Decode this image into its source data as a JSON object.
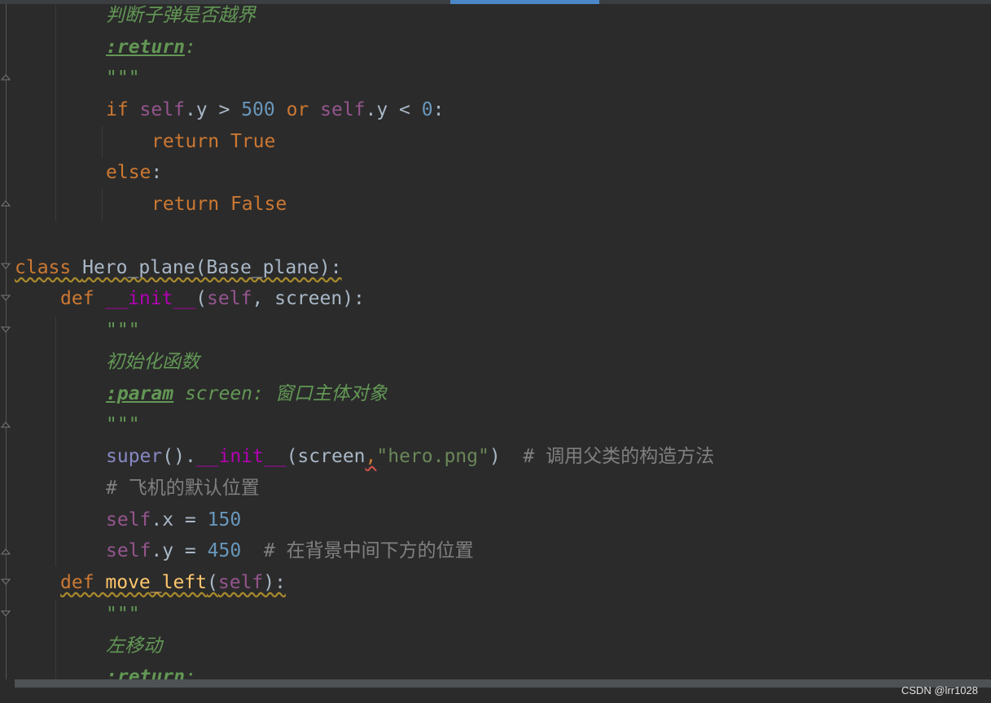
{
  "editor": {
    "lines": [
      {
        "segments": [
          {
            "text": "判断子弹是否越界",
            "cls": "doc"
          }
        ]
      },
      {
        "segments": [
          {
            "text": ":return",
            "cls": "doctag"
          },
          {
            "text": ":",
            "cls": "doc"
          }
        ]
      },
      {
        "segments": [
          {
            "text": "\"\"\"",
            "cls": "doc"
          }
        ]
      },
      {
        "segments": [
          {
            "text": "if ",
            "cls": "kw"
          },
          {
            "text": "self",
            "cls": "self"
          },
          {
            "text": ".y > ",
            "cls": "plain"
          },
          {
            "text": "500",
            "cls": "num"
          },
          {
            "text": " or ",
            "cls": "kw"
          },
          {
            "text": "self",
            "cls": "self"
          },
          {
            "text": ".y < ",
            "cls": "plain"
          },
          {
            "text": "0",
            "cls": "num"
          },
          {
            "text": ":",
            "cls": "plain"
          }
        ]
      },
      {
        "segments": [
          {
            "text": "return ",
            "cls": "kw"
          },
          {
            "text": "True",
            "cls": "kw"
          }
        ]
      },
      {
        "segments": [
          {
            "text": "else",
            "cls": "kw"
          },
          {
            "text": ":",
            "cls": "plain"
          }
        ]
      },
      {
        "segments": [
          {
            "text": "return ",
            "cls": "kw"
          },
          {
            "text": "False",
            "cls": "kw"
          }
        ]
      },
      {
        "segments": []
      },
      {
        "segments": [
          {
            "text": "class ",
            "cls": "kw warn"
          },
          {
            "text": "Hero_plane(Base_plane):",
            "cls": "plain warn"
          }
        ]
      },
      {
        "segments": [
          {
            "text": "def ",
            "cls": "kw"
          },
          {
            "text": "__init__",
            "cls": "magic"
          },
          {
            "text": "(",
            "cls": "plain"
          },
          {
            "text": "self",
            "cls": "self"
          },
          {
            "text": ", screen):",
            "cls": "plain"
          }
        ]
      },
      {
        "segments": [
          {
            "text": "\"\"\"",
            "cls": "doc"
          }
        ]
      },
      {
        "segments": [
          {
            "text": "初始化函数",
            "cls": "doc"
          }
        ]
      },
      {
        "segments": [
          {
            "text": ":param",
            "cls": "doctag"
          },
          {
            "text": " screen: 窗口主体对象",
            "cls": "doc"
          }
        ]
      },
      {
        "segments": [
          {
            "text": "\"\"\"",
            "cls": "doc"
          }
        ]
      },
      {
        "segments": [
          {
            "text": "super",
            "cls": "builtin"
          },
          {
            "text": "().",
            "cls": "plain"
          },
          {
            "text": "__init__",
            "cls": "magic"
          },
          {
            "text": "(screen",
            "cls": "plain"
          },
          {
            "text": ",",
            "cls": "kw err"
          },
          {
            "text": "\"hero.png\"",
            "cls": "str"
          },
          {
            "text": ")  ",
            "cls": "plain"
          },
          {
            "text": "# 调用父类的构造方法",
            "cls": "cmt"
          }
        ]
      },
      {
        "segments": [
          {
            "text": "# 飞机的默认位置",
            "cls": "cmt"
          }
        ]
      },
      {
        "segments": [
          {
            "text": "self",
            "cls": "self"
          },
          {
            "text": ".x = ",
            "cls": "plain"
          },
          {
            "text": "150",
            "cls": "num"
          }
        ]
      },
      {
        "segments": [
          {
            "text": "self",
            "cls": "self"
          },
          {
            "text": ".y = ",
            "cls": "plain"
          },
          {
            "text": "450",
            "cls": "num"
          },
          {
            "text": "  ",
            "cls": "plain"
          },
          {
            "text": "# 在背景中间下方的位置",
            "cls": "cmt"
          }
        ]
      },
      {
        "segments": [
          {
            "text": "def ",
            "cls": "kw warn"
          },
          {
            "text": "move_left",
            "cls": "fn warn"
          },
          {
            "text": "(",
            "cls": "plain warn"
          },
          {
            "text": "self",
            "cls": "self warn"
          },
          {
            "text": "):",
            "cls": "plain warn"
          }
        ]
      },
      {
        "segments": [
          {
            "text": "\"\"\"",
            "cls": "doc"
          }
        ]
      },
      {
        "segments": [
          {
            "text": "左移动",
            "cls": "doc"
          }
        ]
      },
      {
        "segments": [
          {
            "text": ":return",
            "cls": "doctag"
          },
          {
            "text": ":",
            "cls": "doc"
          }
        ]
      }
    ]
  },
  "watermark": "CSDN @lrr1028"
}
